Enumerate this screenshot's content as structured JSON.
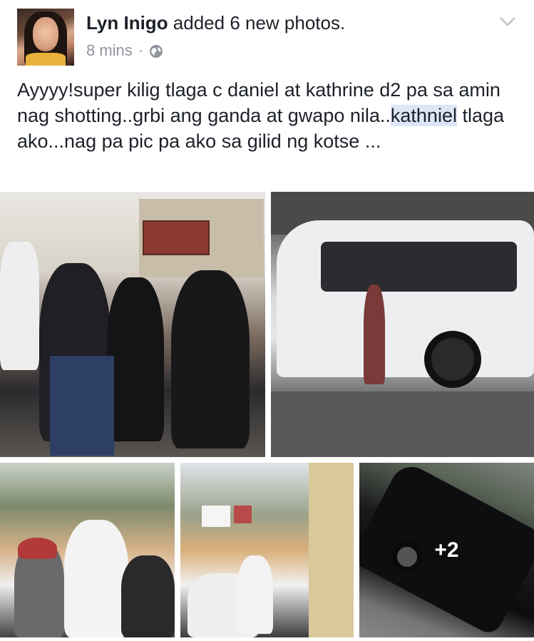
{
  "post": {
    "author": "Lyn Inigo",
    "action": " added 6 new photos.",
    "time": "8 mins",
    "separator": "·",
    "privacy_icon": "globe-icon",
    "menu_icon": "chevron-down-icon",
    "text_before": "Ayyyy!super kilig tlaga c daniel at kathrine d2 pa sa amin nag shotting..grbi ang ganda at gwapo nila..",
    "text_highlight": "kathniel",
    "text_after": " tlaga ako...nag pa pic pa ako sa gilid ng kotse ...",
    "highlight_color": "#dce6f7"
  },
  "photos": {
    "more_count": "+2"
  }
}
